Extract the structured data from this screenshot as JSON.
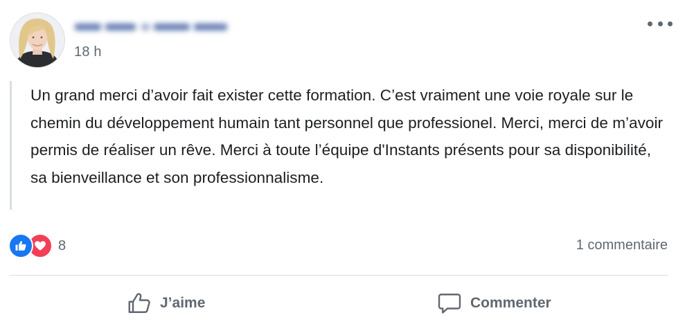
{
  "post": {
    "timestamp": "18 h",
    "text": "Un grand merci d’avoir fait exister cette formation. C’est vraiment une voie royale sur le chemin du développement humain tant personnel que professionel. Merci, merci de m’avoir permis de réaliser un rêve. Merci à toute l’équipe d'Instants présents pour sa disponibilité, sa bienveillance et son professionnalisme."
  },
  "reactions": {
    "types": [
      "like",
      "love"
    ],
    "count": "8"
  },
  "comments": {
    "count_label": "1 commentaire"
  },
  "actions": {
    "like_label": "J’aime",
    "comment_label": "Commenter"
  },
  "icons": {
    "more": "more-horizontal-icon",
    "like_reaction": "thumbs-up-icon",
    "love_reaction": "heart-icon",
    "like_action": "thumbs-up-outline-icon",
    "comment_action": "speech-bubble-icon"
  },
  "colors": {
    "like_blue": "#1877f2",
    "love_red": "#f33e58",
    "secondary_text": "#606770",
    "primary_text": "#1c1e21",
    "divider": "#dadde1"
  }
}
